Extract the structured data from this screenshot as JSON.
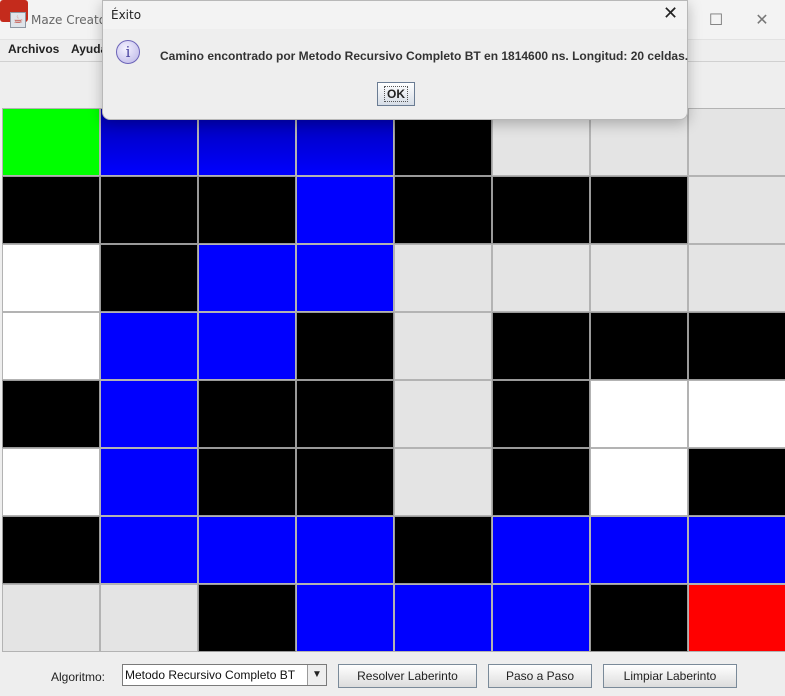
{
  "window": {
    "title": "Maze Creator"
  },
  "menu": {
    "items": [
      "Archivos",
      "Ayuda"
    ]
  },
  "maze": {
    "rows": [
      [
        "green",
        "darkblue",
        "darkblue",
        "darkblue",
        "black",
        "gray",
        "gray",
        "gray"
      ],
      [
        "black",
        "black",
        "black",
        "blue",
        "black",
        "black",
        "black",
        "gray"
      ],
      [
        "white",
        "black",
        "blue",
        "blue",
        "gray",
        "gray",
        "gray",
        "gray"
      ],
      [
        "white",
        "blue",
        "blue",
        "black",
        "gray",
        "black",
        "black",
        "black"
      ],
      [
        "black",
        "blue",
        "black",
        "black",
        "gray",
        "black",
        "white",
        "white"
      ],
      [
        "white",
        "blue",
        "black",
        "black",
        "gray",
        "black",
        "white",
        "black"
      ],
      [
        "black",
        "blue",
        "blue",
        "blue",
        "black",
        "blue",
        "blue",
        "blue"
      ],
      [
        "gray",
        "gray",
        "black",
        "blue",
        "blue",
        "blue",
        "black",
        "red"
      ]
    ]
  },
  "controls": {
    "algorithm_label": "Algoritmo:",
    "algorithm_selected": "Metodo Recursivo Completo BT",
    "solve_button": "Resolver Laberinto",
    "step_button": "Paso a Paso",
    "clear_button": "Limpiar Laberinto"
  },
  "dialog": {
    "title": "Éxito",
    "message": "Camino encontrado por Metodo Recursivo Completo BT en 1814600 ns. Longitud: 20 celdas.",
    "ok_label": "OK",
    "icon": "info-icon"
  }
}
